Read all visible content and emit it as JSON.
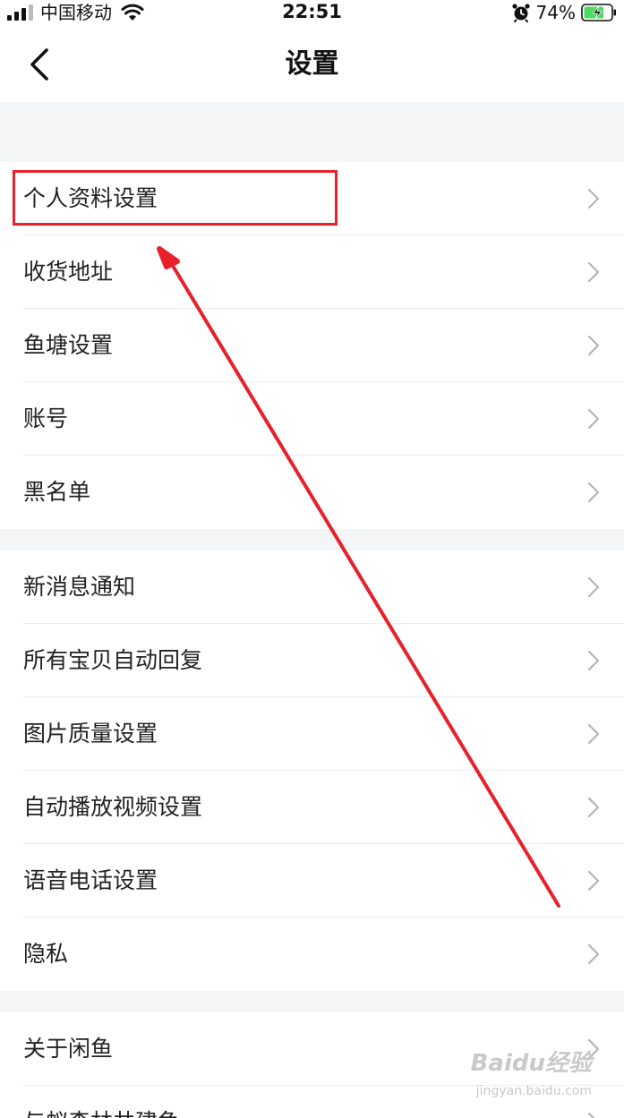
{
  "status_bar": {
    "carrier": "中国移动",
    "time": "22:51",
    "battery_percent": "74%",
    "battery_level": 0.74,
    "icons": [
      "signal-icon",
      "wifi-icon",
      "alarm-icon",
      "battery-charging-icon"
    ]
  },
  "nav": {
    "title": "设置",
    "back_icon": "chevron-left-icon"
  },
  "groups": [
    {
      "items": [
        {
          "label": "个人资料设置"
        },
        {
          "label": "收货地址"
        },
        {
          "label": "鱼塘设置"
        },
        {
          "label": "账号"
        },
        {
          "label": "黑名单"
        }
      ]
    },
    {
      "items": [
        {
          "label": "新消息通知"
        },
        {
          "label": "所有宝贝自动回复"
        },
        {
          "label": "图片质量设置"
        },
        {
          "label": "自动播放视频设置"
        },
        {
          "label": "语音电话设置"
        },
        {
          "label": "隐私"
        }
      ]
    },
    {
      "items": [
        {
          "label": "关于闲鱼"
        },
        {
          "label": "与蚁森林共建鱼"
        }
      ]
    }
  ],
  "annotation": {
    "highlight_color": "#e8202a",
    "arrow_color": "#e8202a"
  },
  "watermark": {
    "brand": "Baidu经验",
    "url": "jingyan.baidu.com"
  },
  "colors": {
    "page_bg": "#f4f5f7",
    "row_bg": "#ffffff",
    "chevron": "#b5b5b5",
    "text": "#222222"
  }
}
